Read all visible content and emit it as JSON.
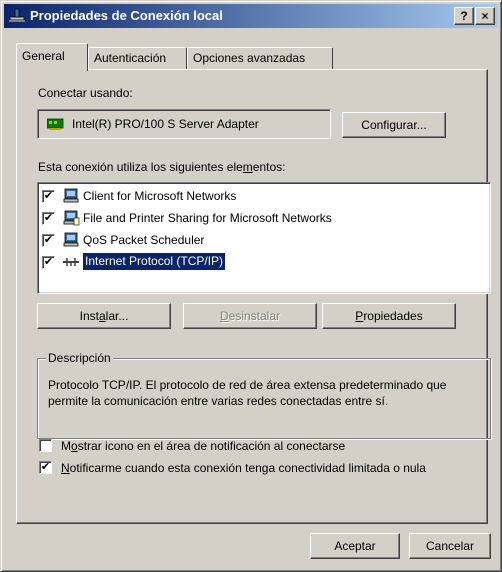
{
  "window": {
    "title": "Propiedades de Conexión local",
    "help_label": "?",
    "close_label": "×"
  },
  "tabs": [
    {
      "label": "General",
      "active": true
    },
    {
      "label": "Autenticación",
      "active": false
    },
    {
      "label": "Opciones avanzadas",
      "active": false
    }
  ],
  "general": {
    "connect_using_label": "Conectar usando:",
    "adapter_name": "Intel(R) PRO/100 S Server Adapter",
    "configure_pre": "Confi",
    "configure_key": "g",
    "configure_post": "urar...",
    "elements_label_pre": "Esta conexión utiliza los siguientes ele",
    "elements_label_key": "m",
    "elements_label_post": "entos:",
    "items": [
      {
        "label": "Client for Microsoft Networks",
        "checked": true,
        "icon": "network-client-icon"
      },
      {
        "label": "File and Printer Sharing for Microsoft Networks",
        "checked": true,
        "icon": "file-printer-sharing-icon"
      },
      {
        "label": "QoS Packet Scheduler",
        "checked": true,
        "icon": "qos-scheduler-icon"
      },
      {
        "label": "Internet Protocol (TCP/IP)",
        "checked": true,
        "icon": "protocol-icon",
        "selected": true
      }
    ],
    "check_mark": "✔",
    "install_pre": "Inst",
    "install_key": "a",
    "install_post": "lar...",
    "uninstall_key": "D",
    "uninstall_post": "esinstalar",
    "properties_key": "P",
    "properties_post": "ropiedades",
    "description_title": "Descripción",
    "description_text": "Protocolo TCP/IP. El protocolo de red de área extensa predeterminado que permite la comunicación entre varias redes conectadas entre sí.",
    "show_icon_pre": "M",
    "show_icon_key": "o",
    "show_icon_post": "strar icono en el área de notificación al conectarse",
    "show_icon_checked": false,
    "notify_key": "N",
    "notify_post": "otificarme cuando esta conexión tenga conectividad limitada o nula",
    "notify_checked": true
  },
  "footer": {
    "accept_label": "Aceptar",
    "cancel_label": "Cancelar"
  },
  "colors": {
    "face": "#d4d0c8",
    "title_start": "#0a246a",
    "title_end": "#a6caf0",
    "selection": "#0a246a"
  }
}
